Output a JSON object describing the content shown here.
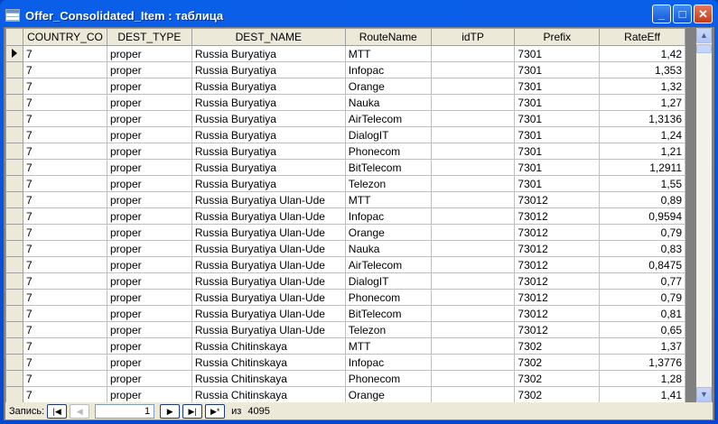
{
  "window": {
    "title": "Offer_Consolidated_Item : таблица",
    "min": "_",
    "max": "□",
    "close": "✕"
  },
  "columns": [
    "COUNTRY_CO",
    "DEST_TYPE",
    "DEST_NAME",
    "RouteName",
    "idTP",
    "Prefix",
    "RateEff"
  ],
  "rows": [
    [
      "7",
      "proper",
      "Russia Buryatiya",
      "MTT",
      "",
      "7301",
      "1,42"
    ],
    [
      "7",
      "proper",
      "Russia Buryatiya",
      "Infopac",
      "",
      "7301",
      "1,353"
    ],
    [
      "7",
      "proper",
      "Russia Buryatiya",
      "Orange",
      "",
      "7301",
      "1,32"
    ],
    [
      "7",
      "proper",
      "Russia Buryatiya",
      "Nauka",
      "",
      "7301",
      "1,27"
    ],
    [
      "7",
      "proper",
      "Russia Buryatiya",
      "AirTelecom",
      "",
      "7301",
      "1,3136"
    ],
    [
      "7",
      "proper",
      "Russia Buryatiya",
      "DialogIT",
      "",
      "7301",
      "1,24"
    ],
    [
      "7",
      "proper",
      "Russia Buryatiya",
      "Phonecom",
      "",
      "7301",
      "1,21"
    ],
    [
      "7",
      "proper",
      "Russia Buryatiya",
      "BitTelecom",
      "",
      "7301",
      "1,2911"
    ],
    [
      "7",
      "proper",
      "Russia Buryatiya",
      "Telezon",
      "",
      "7301",
      "1,55"
    ],
    [
      "7",
      "proper",
      "Russia Buryatiya Ulan-Ude",
      "MTT",
      "",
      "73012",
      "0,89"
    ],
    [
      "7",
      "proper",
      "Russia Buryatiya Ulan-Ude",
      "Infopac",
      "",
      "73012",
      "0,9594"
    ],
    [
      "7",
      "proper",
      "Russia Buryatiya Ulan-Ude",
      "Orange",
      "",
      "73012",
      "0,79"
    ],
    [
      "7",
      "proper",
      "Russia Buryatiya Ulan-Ude",
      "Nauka",
      "",
      "73012",
      "0,83"
    ],
    [
      "7",
      "proper",
      "Russia Buryatiya Ulan-Ude",
      "AirTelecom",
      "",
      "73012",
      "0,8475"
    ],
    [
      "7",
      "proper",
      "Russia Buryatiya Ulan-Ude",
      "DialogIT",
      "",
      "73012",
      "0,77"
    ],
    [
      "7",
      "proper",
      "Russia Buryatiya Ulan-Ude",
      "Phonecom",
      "",
      "73012",
      "0,79"
    ],
    [
      "7",
      "proper",
      "Russia Buryatiya Ulan-Ude",
      "BitTelecom",
      "",
      "73012",
      "0,81"
    ],
    [
      "7",
      "proper",
      "Russia Buryatiya Ulan-Ude",
      "Telezon",
      "",
      "73012",
      "0,65"
    ],
    [
      "7",
      "proper",
      "Russia Chitinskaya",
      "MTT",
      "",
      "7302",
      "1,37"
    ],
    [
      "7",
      "proper",
      "Russia Chitinskaya",
      "Infopac",
      "",
      "7302",
      "1,3776"
    ],
    [
      "7",
      "proper",
      "Russia Chitinskaya",
      "Phonecom",
      "",
      "7302",
      "1,28"
    ],
    [
      "7",
      "proper",
      "Russia Chitinskaya",
      "Orange",
      "",
      "7302",
      "1,41"
    ]
  ],
  "nav": {
    "label": "Запись:",
    "current": "1",
    "of": "из",
    "total": "4095"
  }
}
